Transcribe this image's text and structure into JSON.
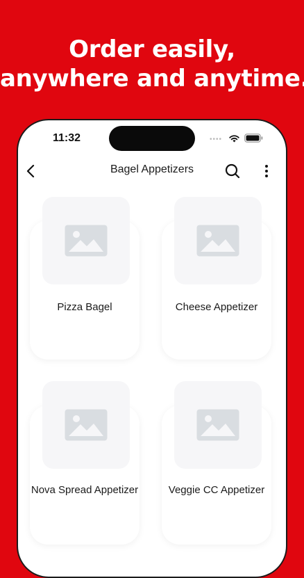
{
  "promo": {
    "headline_line1": "Order easily,",
    "headline_line2": "anywhere and anytime."
  },
  "status_bar": {
    "time": "11:32",
    "dots": "••••"
  },
  "app_bar": {
    "title": "Bagel Appetizers"
  },
  "products": [
    {
      "name": "Pizza Bagel"
    },
    {
      "name": "Cheese Appetizer"
    },
    {
      "name": "Nova Spread Appetizer"
    },
    {
      "name": "Veggie CC Appetizer"
    }
  ],
  "icons": {
    "back": "back-arrow-icon",
    "search": "search-icon",
    "more": "more-vertical-icon",
    "placeholder": "image-placeholder-icon"
  },
  "colors": {
    "brand": "#e0060f",
    "placeholder_bg": "#f6f6f8",
    "placeholder_icon": "#d9dde1"
  }
}
